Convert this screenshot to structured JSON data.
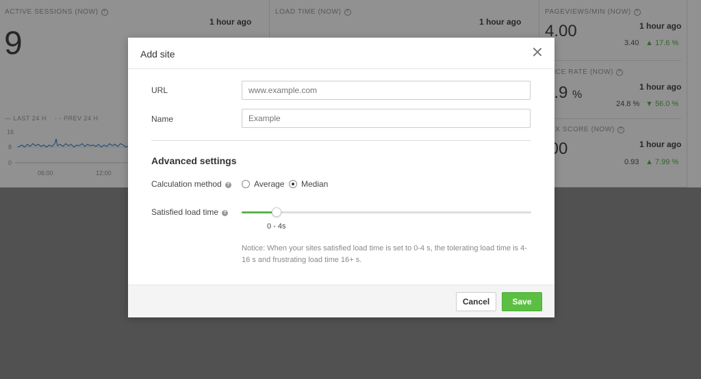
{
  "dashboard": {
    "sessions": {
      "label": "ACTIVE SESSIONS (NOW)",
      "value": "9",
      "ago": "1 hour ago",
      "legend_last": "LAST 24 H",
      "legend_prev": "PREV 24 H",
      "y_ticks": [
        "16",
        "8",
        "0"
      ],
      "x_ticks": [
        "06:00",
        "12:00"
      ]
    },
    "load_time": {
      "label": "LOAD TIME (NOW)",
      "ago": "1 hour ago"
    },
    "pageviews": {
      "label": "PAGEVIEWS/MIN (NOW)",
      "value": "4.00",
      "ago": "1 hour ago",
      "prev": "3.40",
      "change": "▲ 17.6 %"
    },
    "bounce": {
      "label": "UNCE RATE (NOW)",
      "value": "0.9",
      "unit": "%",
      "ago": "1 hour ago",
      "prev": "24.8 %",
      "change": "▼ 56.0 %"
    },
    "index": {
      "label": "DEX SCORE (NOW)",
      "value": ".00",
      "ago": "1 hour ago",
      "prev": "0.93",
      "change": "▲ 7.99 %"
    }
  },
  "modal": {
    "title": "Add site",
    "url_label": "URL",
    "url_placeholder": "www.example.com",
    "name_label": "Name",
    "name_placeholder": "Example",
    "advanced_title": "Advanced settings",
    "calc_label": "Calculation method",
    "calc_options": [
      "Average",
      "Median"
    ],
    "calc_selected": "Median",
    "satisfied_label": "Satisfied load time",
    "slider_value": "0 - 4s",
    "slider_fraction": 0.12,
    "notice": "Notice: When your sites satisfied load time is set to 0-4 s, the tolerating load time is 4-16 s and frustrating load time 16+ s.",
    "cancel_label": "Cancel",
    "save_label": "Save"
  },
  "colors": {
    "accent_green": "#5bb34a",
    "save_button": "#5bbf44"
  }
}
